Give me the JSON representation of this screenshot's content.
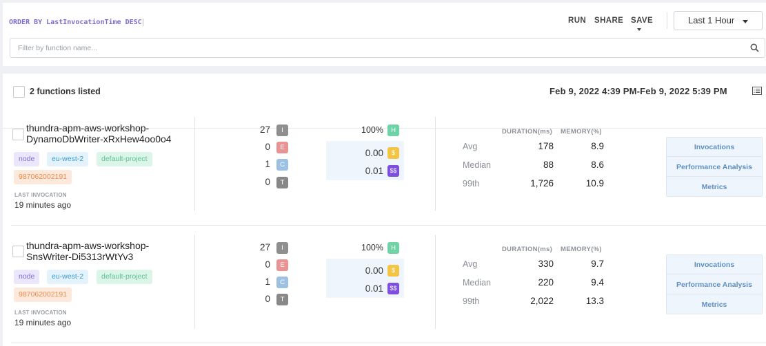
{
  "query": {
    "text": "ORDER BY LastInvocationTime DESC",
    "actions": {
      "run": "RUN",
      "share": "SHARE",
      "save": "SAVE"
    },
    "time_range": "Last 1 Hour",
    "filter_placeholder": "Filter by function name..."
  },
  "list": {
    "count_label": "2 functions listed",
    "range_label": "Feb 9, 2022 4:39 PM-Feb 9, 2022 5:39 PM",
    "stats_headers": {
      "duration": "DURATION(ms)",
      "memory": "MEMORY(%)"
    },
    "stat_labels": {
      "avg": "Avg",
      "median": "Median",
      "p99": "99th"
    },
    "links": {
      "invocations": "Invocations",
      "performance": "Performance Analysis",
      "metrics": "Metrics"
    },
    "last_invocation_label": "LAST INVOCATION",
    "functions": [
      {
        "name_line1": "thundra-apm-aws-workshop-",
        "name_line2": "DynamoDbWriter-xRxHew4oo0o4",
        "tags": {
          "runtime": "node",
          "region": "eu-west-2",
          "project": "default-project",
          "account": "987062002191"
        },
        "last_invocation": "19 minutes ago",
        "counts": {
          "invocations": "27",
          "errors": "0",
          "cold_starts": "1",
          "timeouts": "0"
        },
        "badges": {
          "i": "I",
          "e": "E",
          "c": "C",
          "t": "T",
          "h": "H",
          "cost": "$",
          "cost_est": "$$"
        },
        "health": "100%",
        "cost": "0.00",
        "estimated_cost": "0.01",
        "stats": {
          "avg": {
            "duration": "178",
            "memory": "8.9"
          },
          "median": {
            "duration": "88",
            "memory": "8.6"
          },
          "p99": {
            "duration": "1,726",
            "memory": "10.9"
          }
        }
      },
      {
        "name_line1": "thundra-apm-aws-workshop-",
        "name_line2": "SnsWriter-Di5313rWtYv3",
        "tags": {
          "runtime": "node",
          "region": "eu-west-2",
          "project": "default-project",
          "account": "987062002191"
        },
        "last_invocation": "19 minutes ago",
        "counts": {
          "invocations": "27",
          "errors": "0",
          "cold_starts": "1",
          "timeouts": "0"
        },
        "badges": {
          "i": "I",
          "e": "E",
          "c": "C",
          "t": "T",
          "h": "H",
          "cost": "$",
          "cost_est": "$$"
        },
        "health": "100%",
        "cost": "0.00",
        "estimated_cost": "0.01",
        "stats": {
          "avg": {
            "duration": "330",
            "memory": "9.7"
          },
          "median": {
            "duration": "220",
            "memory": "9.4"
          },
          "p99": {
            "duration": "2,022",
            "memory": "13.3"
          }
        }
      }
    ]
  },
  "colors": {
    "accent_link": "#5f8fc2",
    "query_text": "#7b6fd0",
    "badge_health": "#6fd3a8",
    "badge_cost": "#f4c542",
    "badge_cost_est": "#7d4ee0",
    "badge_error": "#e89494",
    "badge_cold": "#9dc1e2"
  }
}
